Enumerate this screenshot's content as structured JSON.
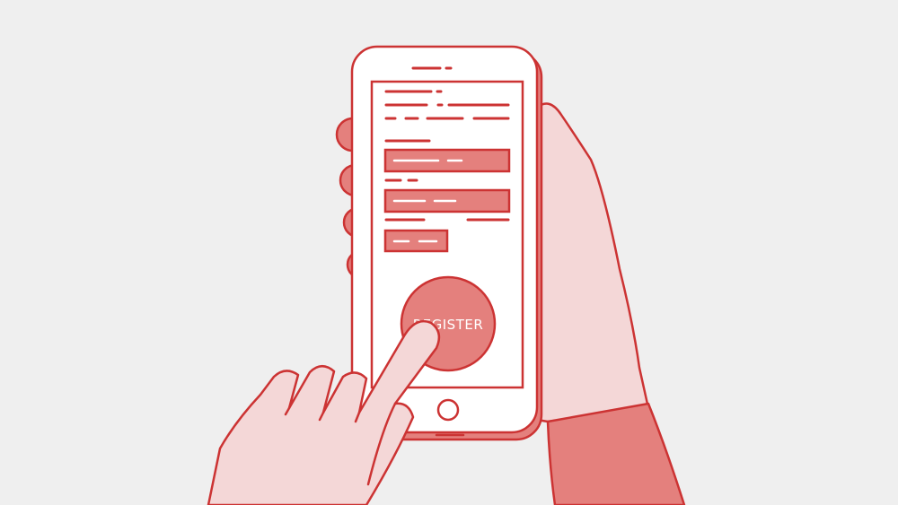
{
  "register_button": {
    "label": "REGISTER"
  },
  "colors": {
    "background": "#efefef",
    "stroke": "#cc3333",
    "fill_light": "#f4d7d7",
    "fill_medium": "#e4807d",
    "white": "#ffffff"
  },
  "icons": {
    "home_button": "circle-home-icon",
    "speaker": "speaker-slot-icon"
  }
}
